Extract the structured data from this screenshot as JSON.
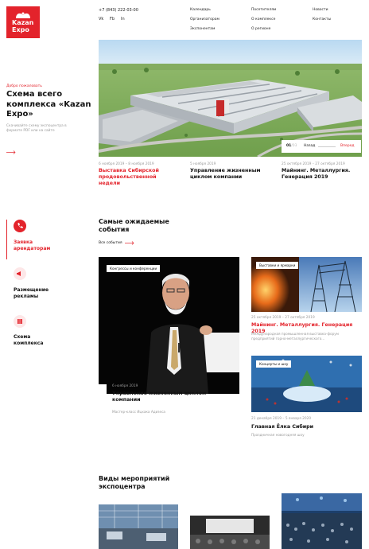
{
  "logo": {
    "line1": "Kazan",
    "line2": "Expo"
  },
  "contacts": {
    "phone": "+7 (843) 222-03-00",
    "social": [
      "Vk",
      "Fb",
      "In"
    ]
  },
  "nav": {
    "col1": [
      "Календарь",
      "Организаторам",
      "Экспонентам"
    ],
    "col2": [
      "Посетителям",
      "О комплексе",
      "О регионе"
    ],
    "col3": [
      "Новости",
      "Контакты"
    ]
  },
  "hero": {
    "welcome": "Добро пожаловать",
    "title": "Схема всего комплекса «Kazan Expo»",
    "desc": "Скачивайте схему экспоцентра в формате PDF или на сайте",
    "slider": {
      "current": "01",
      "total": "/03",
      "back": "Назад",
      "forward": "Вперед"
    }
  },
  "hero_events": [
    {
      "date": "6 ноября 2019 – 8 ноября 2019",
      "title": "Выставка Сибирской продовольственной недели"
    },
    {
      "date": "5 ноября 2019",
      "title": "Управление жизненным циклом компании"
    },
    {
      "date": "25 октября 2019 – 27 октября 2019",
      "title": "Майнинг. Металлургия. Генерация 2019"
    }
  ],
  "sidebar": [
    {
      "label": "Заявка арендаторам"
    },
    {
      "label": "Размещение рекламы"
    },
    {
      "label": "Схема комплекса"
    }
  ],
  "popular": {
    "title": "Самые ожидаемые события",
    "all_link": "Все события",
    "cards": [
      {
        "badge": "Конгрессы и конференции",
        "date": "6 ноября 2019",
        "title": "Управление жизненным циклом компании",
        "desc": "Мастер-класс Ицхака Адизеса"
      },
      {
        "badge": "Выставки и ярмарки",
        "date": "25 октября 2019 – 27 октября 2019",
        "title": "Майнинг. Металлургия. Генерация 2019",
        "desc": "Международная промышленная выставка-форум предприятий горно-металлургического..."
      },
      {
        "badge": "Концерты и шоу",
        "date": "21 декабря 2019 – 5 января 2020",
        "title": "Главная Ёлка Сибири",
        "desc": "Праздничная новогодняя шоу"
      }
    ]
  },
  "types": {
    "title": "Виды мероприятий экспоцентра"
  },
  "colors": {
    "accent": "#e3232b",
    "text": "#1c1c1c",
    "muted": "#999999"
  }
}
